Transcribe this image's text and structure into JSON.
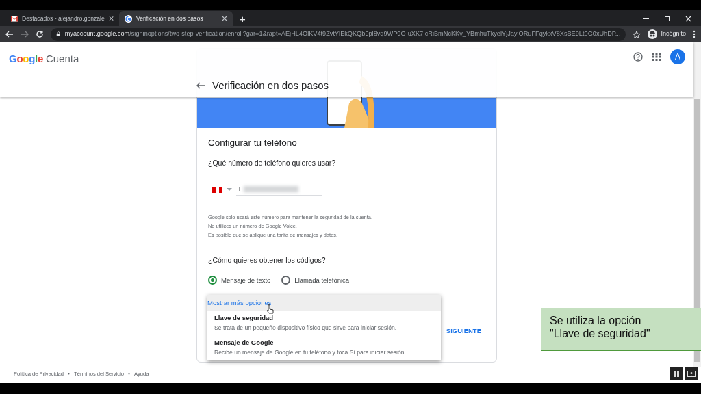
{
  "browser": {
    "tabs": [
      {
        "kind": "mail",
        "label": "Destacados - alejandro.gonzale",
        "selected": false
      },
      {
        "kind": "google",
        "label": "Verificación en dos pasos",
        "selected": true
      }
    ],
    "new_tab": "+",
    "url_host": "myaccount.google.com",
    "url_path": "/signinoptions/two-step-verification/enroll?gar=1&rapt=AEjHL4OlKV4t9ZvtYlEkQKQb9pl8vq9WP9O-uXK7IcRiBmNcKKv_YBmhuTkyelYjJaylORuFFqykxV8XsBE9Lt0G0xUhDP...",
    "profile": "Incógnito"
  },
  "app_header": {
    "logo": "Google",
    "product": "Cuenta",
    "avatar": "A"
  },
  "page_title": "Verificación en dos pasos",
  "setup": {
    "heading": "Configurar tu teléfono",
    "question": "¿Qué número de teléfono quieres usar?",
    "phone_prefix": "+",
    "notes": [
      "Google solo usará este número para mantener la seguridad de la cuenta.",
      "No utilices un número de Google Voice.",
      "Es posible que se aplique una tarifa de mensajes y datos."
    ],
    "codes_question": "¿Cómo quieres obtener los códigos?",
    "methods": [
      {
        "label": "Mensaje de texto",
        "selected": true
      },
      {
        "label": "Llamada telefónica",
        "selected": false
      }
    ],
    "more_options": "Mostrar más opciones",
    "options": [
      {
        "title": "Llave de seguridad",
        "description": "Se trata de un pequeño dispositivo físico que sirve para iniciar sesión."
      },
      {
        "title": "Mensaje de Google",
        "description": "Recibe un mensaje de Google en tu teléfono y toca Sí para iniciar sesión."
      }
    ],
    "next": "SIGUIENTE"
  },
  "footer": [
    "Política de Privacidad",
    "Términos del Servicio",
    "Ayuda"
  ],
  "annotation": [
    "Se utiliza la opción",
    "\"Llave de seguridad\""
  ]
}
